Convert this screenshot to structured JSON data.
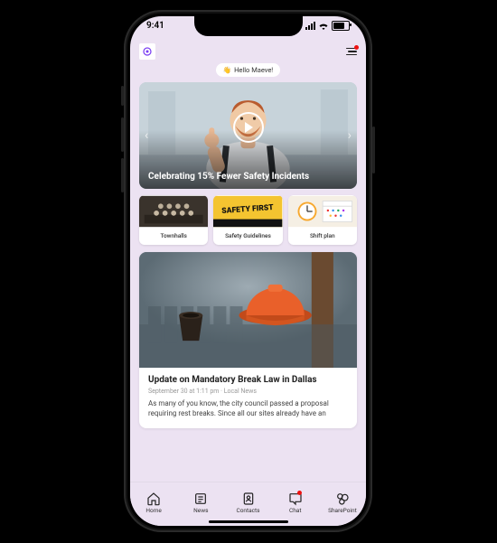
{
  "status": {
    "time": "9:41"
  },
  "greeting": {
    "emoji": "👋",
    "text": "Hello Maeve!"
  },
  "hero": {
    "title": "Celebrating 15% Fewer Safety Incidents"
  },
  "tiles": [
    {
      "label": "Townhalls"
    },
    {
      "label": "Safety Guidelines"
    },
    {
      "label": "Shift plan"
    }
  ],
  "article": {
    "title": "Update on Mandatory Break Law in Dallas",
    "meta": "September 30 at 1:11 pm · Local News",
    "body": "As many of you know, the city council passed a proposal requiring rest breaks. Since all our sites already have an"
  },
  "nav": [
    {
      "label": "Home"
    },
    {
      "label": "News"
    },
    {
      "label": "Contacts"
    },
    {
      "label": "Chat"
    },
    {
      "label": "SharePoint"
    }
  ]
}
